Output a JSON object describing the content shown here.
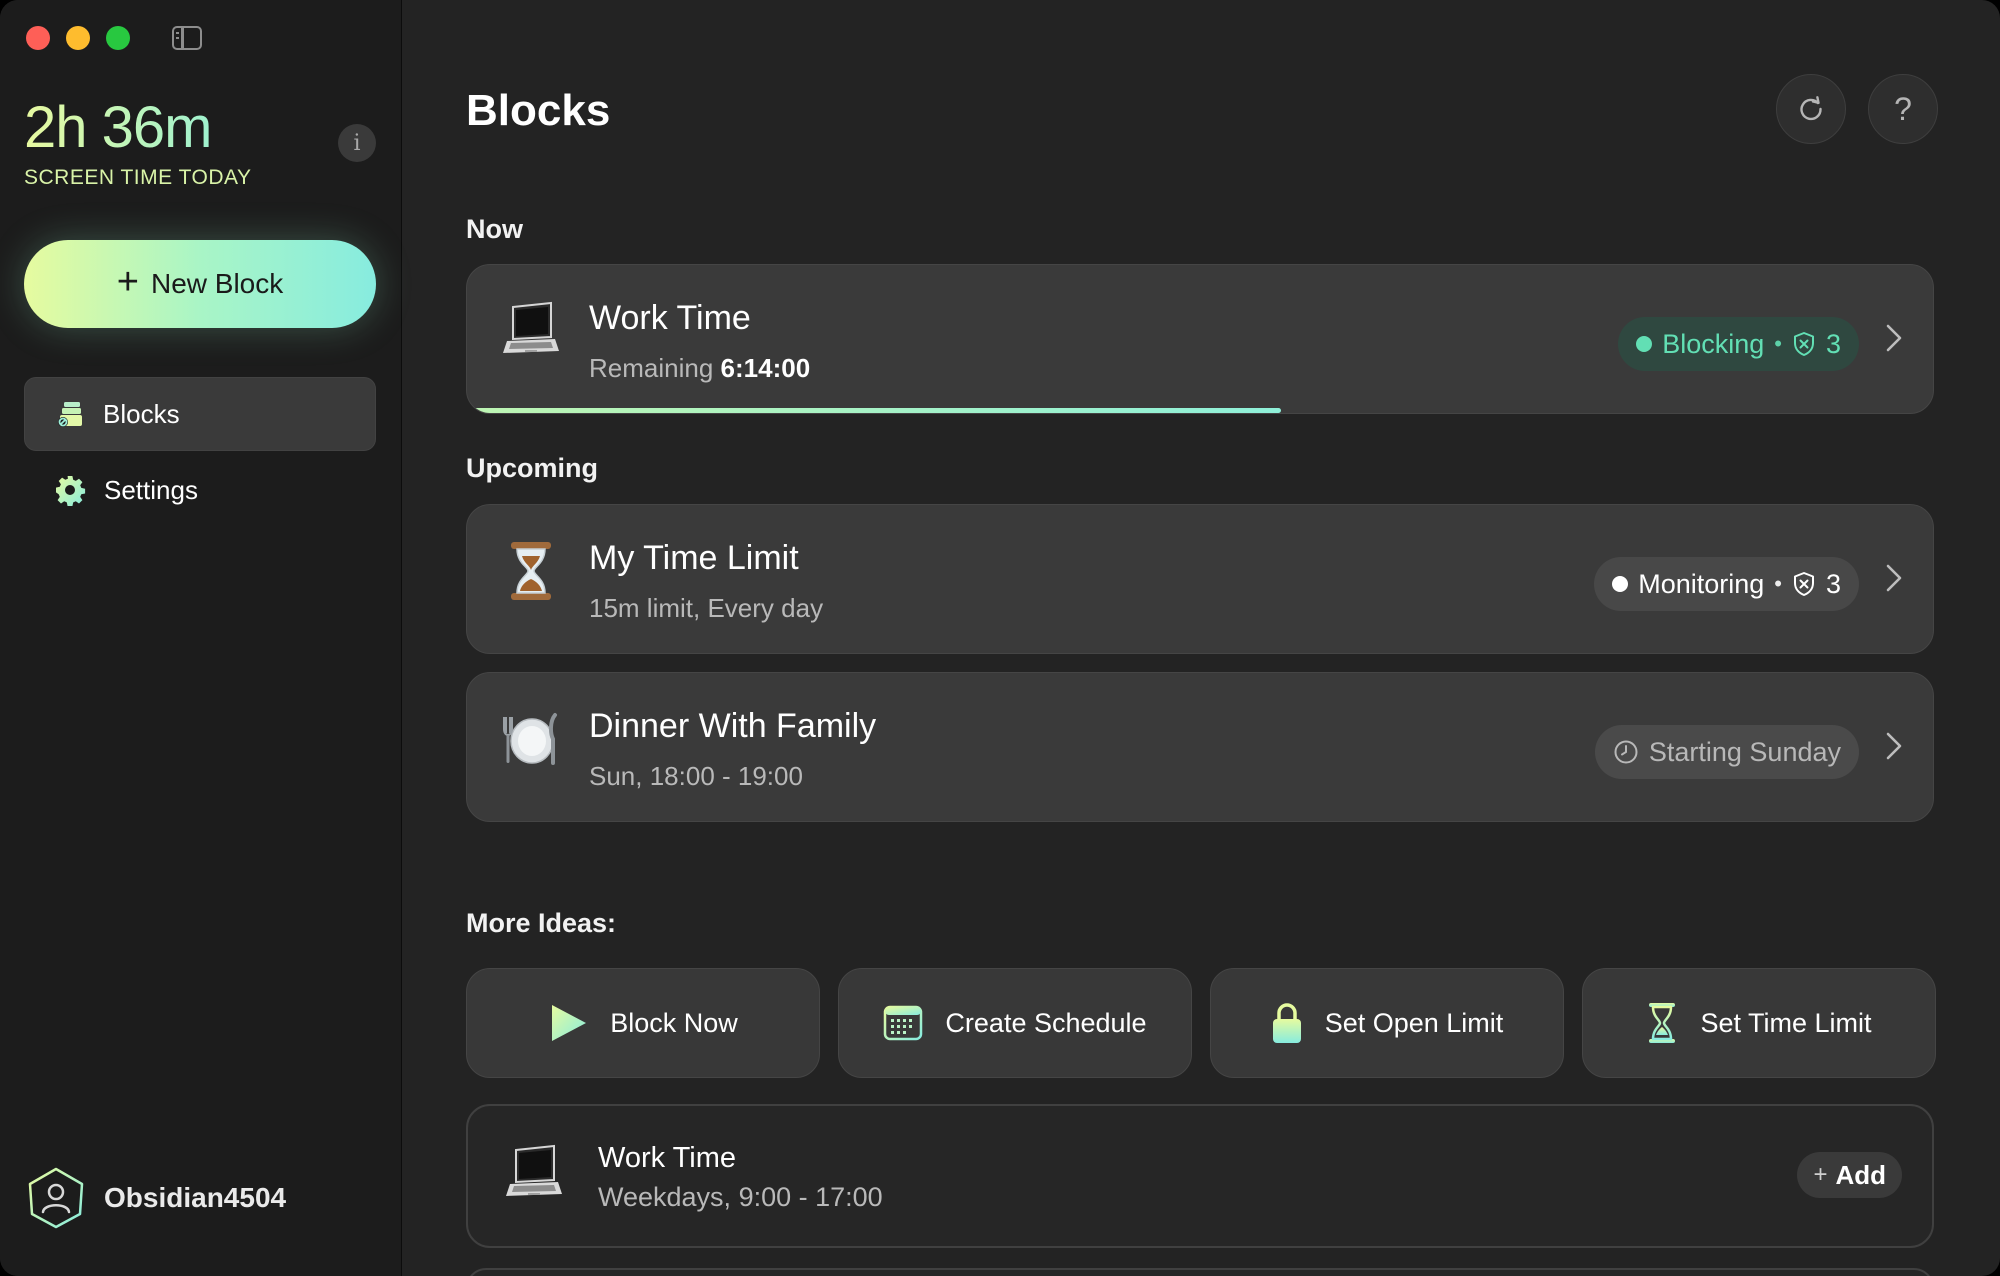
{
  "sidebar": {
    "screen_time_value": "2h 36m",
    "screen_time_label": "SCREEN TIME TODAY",
    "info_glyph": "i",
    "new_block_label": "New Block",
    "nav": [
      {
        "label": "Blocks",
        "icon": "blocks-icon",
        "active": true
      },
      {
        "label": "Settings",
        "icon": "gear-icon",
        "active": false
      }
    ],
    "account_name": "Obsidian4504"
  },
  "main": {
    "title": "Blocks",
    "help_glyph": "?",
    "sections": {
      "now": "Now",
      "upcoming": "Upcoming",
      "ideas": "More Ideas:"
    },
    "now_card": {
      "title": "Work Time",
      "subtitle_prefix": "Remaining",
      "remaining": "6:14:00",
      "status": "Blocking",
      "shield_count": "3",
      "progress": 0.555,
      "icon": "laptop-icon"
    },
    "upcoming": [
      {
        "title": "My Time Limit",
        "subtitle": "15m limit, Every day",
        "status": "Monitoring",
        "shield_count": "3",
        "icon": "hourglass-icon"
      },
      {
        "title": "Dinner With Family",
        "subtitle": "Sun, 18:00 - 19:00",
        "status": "Starting Sunday",
        "icon": "plate-icon"
      }
    ],
    "ideas": [
      {
        "label": "Block Now",
        "icon": "play-icon"
      },
      {
        "label": "Create Schedule",
        "icon": "calendar-icon"
      },
      {
        "label": "Set Open Limit",
        "icon": "lock-icon"
      },
      {
        "label": "Set Time Limit",
        "icon": "hourglass-icon"
      }
    ],
    "suggestion": {
      "title": "Work Time",
      "subtitle": "Weekdays, 9:00 - 17:00",
      "add_label": "Add"
    }
  },
  "colors": {
    "accent_start": "#e6fb9f",
    "accent_end": "#87ecdf",
    "blocking_green": "#62dfb4",
    "window_bg": "#232323",
    "sidebar_bg": "#1c1c1c"
  }
}
